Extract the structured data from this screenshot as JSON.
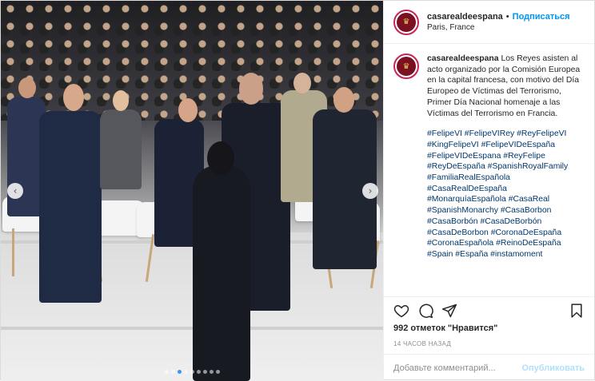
{
  "account": {
    "username": "casarealdeespana",
    "bullet": "•",
    "follow_label": "Подписаться",
    "location": "Paris, France",
    "avatar_glyph": "♛"
  },
  "caption": {
    "username": "casarealdeespana",
    "text": "Los Reyes asisten al acto organizado por la Comisión Europea en la capital francesa, con motivo del Día Europeo de Víctimas del Terrorismo, Primer Día Nacional homenaje a las Víctimas del Terrorismo en Francia.",
    "hashtags": [
      "#FelipeVI",
      "#FelipeVIRey",
      "#ReyFelipeVI",
      "#KingFelipeVI",
      "#FelipeVIDeEspaña",
      "#FelipeVIDeEspana",
      "#ReyFelipe",
      "#ReyDeEspaña",
      "#SpanishRoyalFamily",
      "#FamiliaRealEspañola",
      "#CasaRealDeEspaña",
      "#MonarquíaEspañola",
      "#CasaReal",
      "#SpanishMonarchy",
      "#CasaBorbon",
      "#CasaBorbón",
      "#CasaDeBorbón",
      "#CasaDeBorbon",
      "#CoronaDeEspaña",
      "#CoronaEspañola",
      "#ReinoDeEspaña",
      "#Spain",
      "#España",
      "#instamoment"
    ]
  },
  "stats": {
    "likes": "992 отметок \"Нравится\"",
    "time": "14 ЧАСОВ НАЗАД"
  },
  "comment_box": {
    "placeholder": "Добавьте комментарий...",
    "publish_label": "Опубликовать"
  },
  "carousel": {
    "prev_glyph": "‹",
    "next_glyph": "›",
    "dot_count": 9,
    "active_dot": 2
  },
  "icons": {
    "like": "heart-icon",
    "comment": "comment-icon",
    "share": "share-icon",
    "save": "bookmark-icon"
  },
  "colors": {
    "link_blue": "#0095f6",
    "hashtag": "#00376b",
    "muted": "#8e8e8e",
    "publish_disabled": "#b2dffc"
  }
}
